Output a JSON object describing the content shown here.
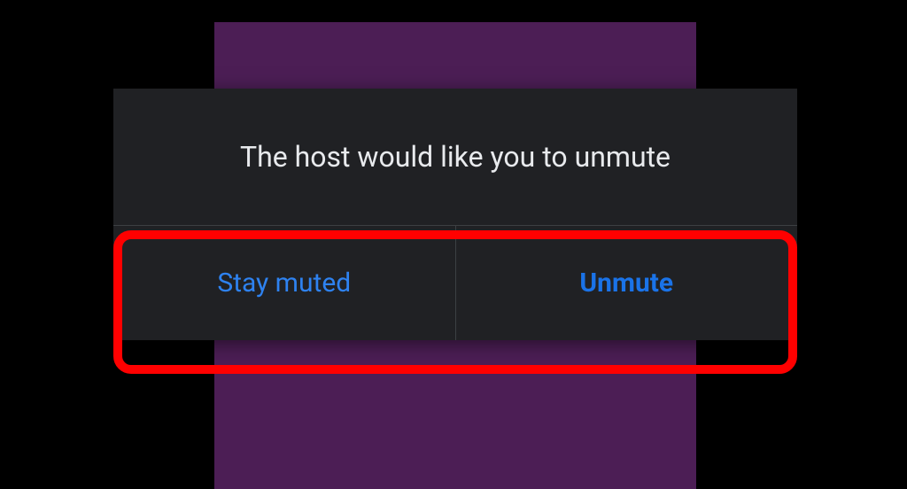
{
  "dialog": {
    "message": "The host would like you to unmute",
    "buttons": {
      "stay_muted": "Stay muted",
      "unmute": "Unmute"
    }
  }
}
